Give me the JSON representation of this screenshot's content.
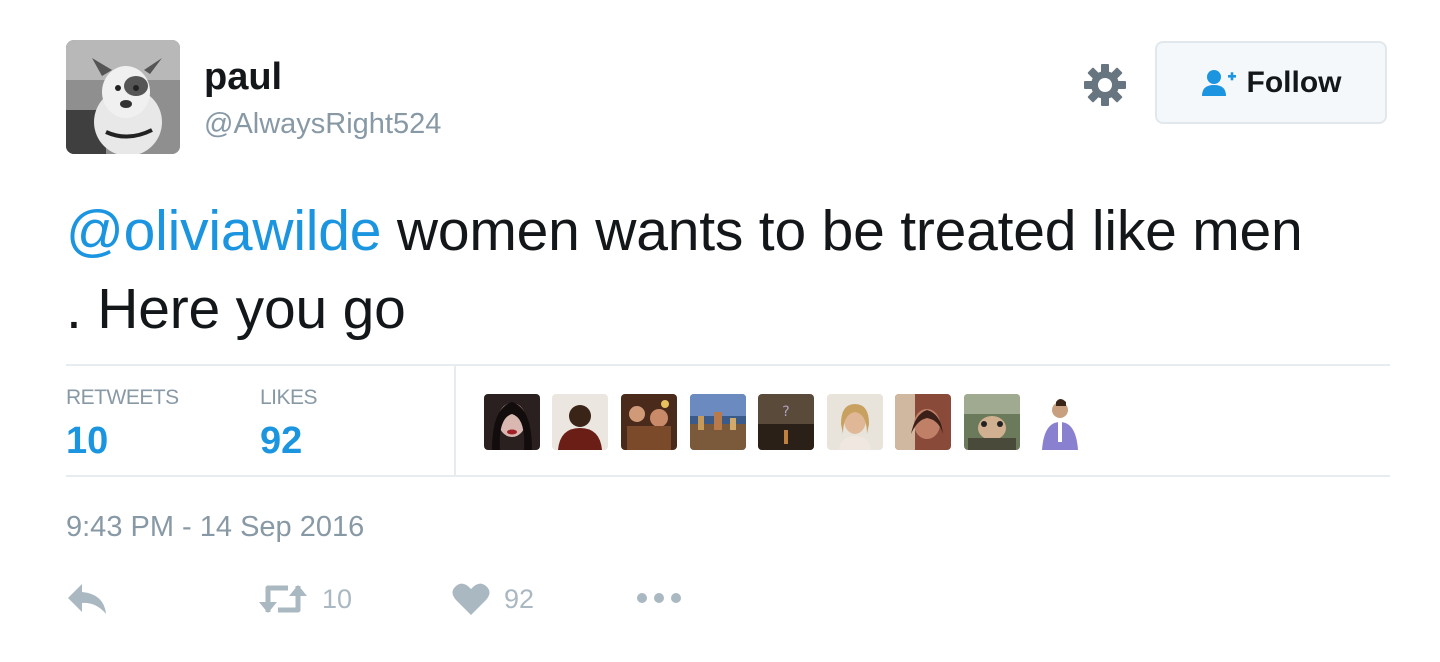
{
  "user": {
    "name": "paul",
    "handle": "@AlwaysRight524"
  },
  "follow_button": {
    "label": "Follow"
  },
  "tweet": {
    "mention": "@oliviawilde",
    "text_line1": " women wants to be treated like men",
    "text_line2": ". Here you go"
  },
  "stats": {
    "retweets_label": "RETWEETS",
    "retweets_value": "10",
    "likes_label": "LIKES",
    "likes_value": "92"
  },
  "timestamp": "9:43 PM - 14 Sep 2016",
  "actions": {
    "retweet_count": "10",
    "like_count": "92"
  },
  "colors": {
    "accent": "#1b95e0",
    "muted": "#8899a6",
    "icon": "#aab8c2",
    "text": "#14171a"
  },
  "icons": [
    "gear-icon",
    "follow-person-plus-icon",
    "reply-icon",
    "retweet-icon",
    "heart-icon",
    "more-dots-icon"
  ]
}
